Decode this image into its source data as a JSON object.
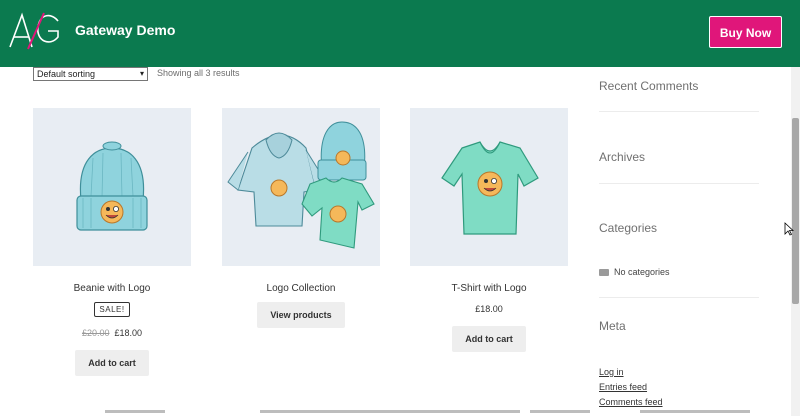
{
  "header": {
    "logo_text": "AG",
    "title": "Gateway Demo",
    "buy_button": "Buy Now",
    "bg_color": "#0b7a4f",
    "button_color": "#e0167a"
  },
  "toolbar": {
    "sort_selected": "Default sorting",
    "result_count": "Showing all 3 results"
  },
  "products": [
    {
      "title": "Beanie with Logo",
      "badge": "SALE!",
      "price_old": "£20.00",
      "price": "£18.00",
      "button": "Add to cart"
    },
    {
      "title": "Logo Collection",
      "button": "View products"
    },
    {
      "title": "T-Shirt with Logo",
      "price": "£18.00",
      "button": "Add to cart"
    }
  ],
  "sidebar": {
    "recent_comments": "Recent Comments",
    "archives": "Archives",
    "categories": "Categories",
    "no_categories": "No categories",
    "meta": "Meta",
    "meta_links": [
      "Log in",
      "Entries feed",
      "Comments feed"
    ]
  }
}
